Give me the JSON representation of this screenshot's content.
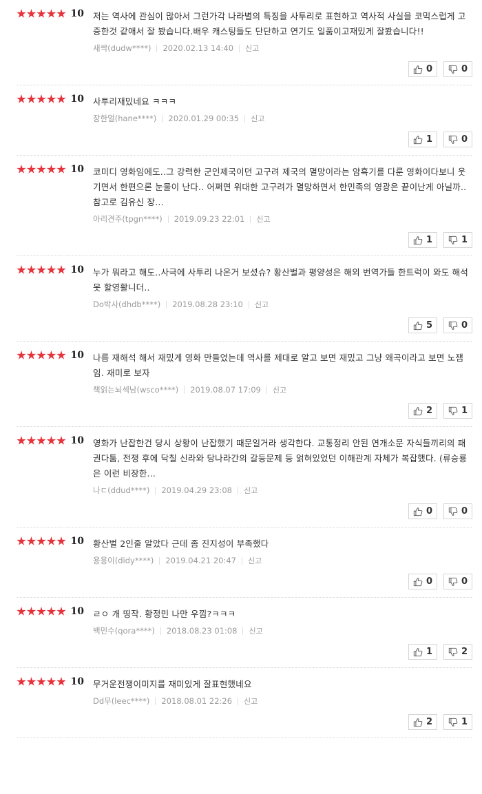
{
  "reviews": [
    {
      "score": "10",
      "stars": 5,
      "text": "저는 역사에 관심이 많아서 그런가각 나라별의 특징을 사투리로 표현하고 역사적 사실을 코믹스럽게 고증한것 같애서 잘 봤습니다.배우 캐스팅들도 단단하고 연기도 일품이고재밌게 잘봤습니다!!",
      "author": "새싹(dudw****)",
      "date": "2020.02.13 14:40",
      "report": "신고",
      "up": "0",
      "down": "0"
    },
    {
      "score": "10",
      "stars": 5,
      "text": "사투리재밌네요 ㅋㅋㅋ",
      "author": "장한얼(hane****)",
      "date": "2020.01.29 00:35",
      "report": "신고",
      "up": "1",
      "down": "0"
    },
    {
      "score": "10",
      "stars": 5,
      "text": "코미디 영화임에도..그 강력한 군인제국이던 고구려 제국의 멸망이라는 암흑기를 다룬 영화이다보니 웃기면서 한편으론 눈물이 난다.. 어쩌면 위대한 고구려가 멸망하면서 한민족의 영광은 끝이난게 아닐까.. 참고로 김유신 장...",
      "author": "아리견주(tpgn****)",
      "date": "2019.09.23 22:01",
      "report": "신고",
      "up": "1",
      "down": "1"
    },
    {
      "score": "10",
      "stars": 5,
      "text": "누가 뭐라고 해도..사극에 사투리 나온거 보셨슈? 황산벌과 평양성은 해외 번역가들 한트럭이 와도 해석 못 할영활니더..",
      "author": "Do박사(dhdb****)",
      "date": "2019.08.28 23:10",
      "report": "신고",
      "up": "5",
      "down": "0"
    },
    {
      "score": "10",
      "stars": 5,
      "text": "나름 재해석 해서 재밌게 영화 만들었는데 역사를 제대로 알고 보면 재밌고 그냥 왜곡이라고 보면 노잼임. 재미로 보자",
      "author": "책읽는뇌섹남(wsco****)",
      "date": "2019.08.07 17:09",
      "report": "신고",
      "up": "2",
      "down": "1"
    },
    {
      "score": "10",
      "stars": 5,
      "text": "영화가 난잡한건 당시 상황이 난잡했기 때문일거라 생각한다. 교통정리 안된 연개소문 자식들끼리의 패권다툼, 전쟁 후에 닥칠 신라와 당나라간의 갈등문제 등 얽혀있었던 이해관계 자체가 복잡했다. (류승룡은 이런 비장한...",
      "author": "나ㄷ(ddud****)",
      "date": "2019.04.29 23:08",
      "report": "신고",
      "up": "0",
      "down": "0"
    },
    {
      "score": "10",
      "stars": 5,
      "text": "황산벌 2인줄 알았다 근데 좀 진지성이 부족했다",
      "author": "용용이(didy****)",
      "date": "2019.04.21 20:47",
      "report": "신고",
      "up": "0",
      "down": "0"
    },
    {
      "score": "10",
      "stars": 5,
      "text": "ㄹㅇ 개 띵작. 황정민 나만 우낌?ㅋㅋㅋ",
      "author": "백민수(qora****)",
      "date": "2018.08.23 01:08",
      "report": "신고",
      "up": "1",
      "down": "2"
    },
    {
      "score": "10",
      "stars": 5,
      "text": "무거운전쟁이미지를 재미있게 잘표현했네요",
      "author": "Dd무(leec****)",
      "date": "2018.08.01 22:26",
      "report": "신고",
      "up": "2",
      "down": "1"
    }
  ],
  "icons": {
    "like": "thumbs-up-icon",
    "dislike": "thumbs-down-icon",
    "star": "star-icon"
  },
  "colors": {
    "star": "#e5333c",
    "text": "#333333",
    "meta": "#999999"
  }
}
